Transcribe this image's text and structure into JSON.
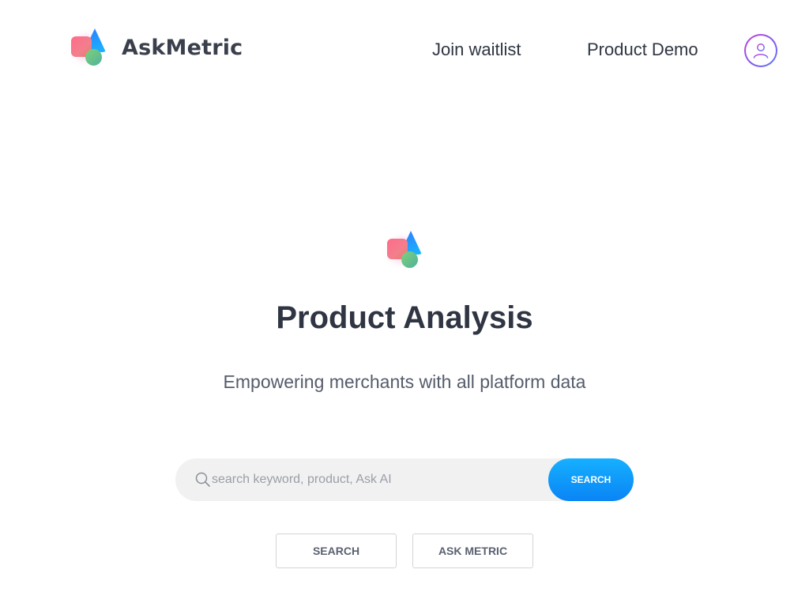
{
  "header": {
    "brand_name": "AskMetric",
    "nav": {
      "join_waitlist": "Join waitlist",
      "product_demo": "Product Demo"
    },
    "avatar_icon": "user-icon"
  },
  "hero": {
    "logo_icon": "askmetric-logo-icon",
    "title": "Product Analysis",
    "subtitle": "Empowering merchants with all platform data"
  },
  "search": {
    "icon": "search-icon",
    "value": "",
    "placeholder": "search keyword, product, Ask AI",
    "button_label": "SEARCH"
  },
  "actions": {
    "search_label": "SEARCH",
    "ask_metric_label": "ASK METRIC"
  },
  "colors": {
    "primary_blue": "#0a84f5",
    "text_dark": "#2f3542",
    "avatar_gradient_start": "#c542d6",
    "avatar_gradient_end": "#5a7cff"
  }
}
